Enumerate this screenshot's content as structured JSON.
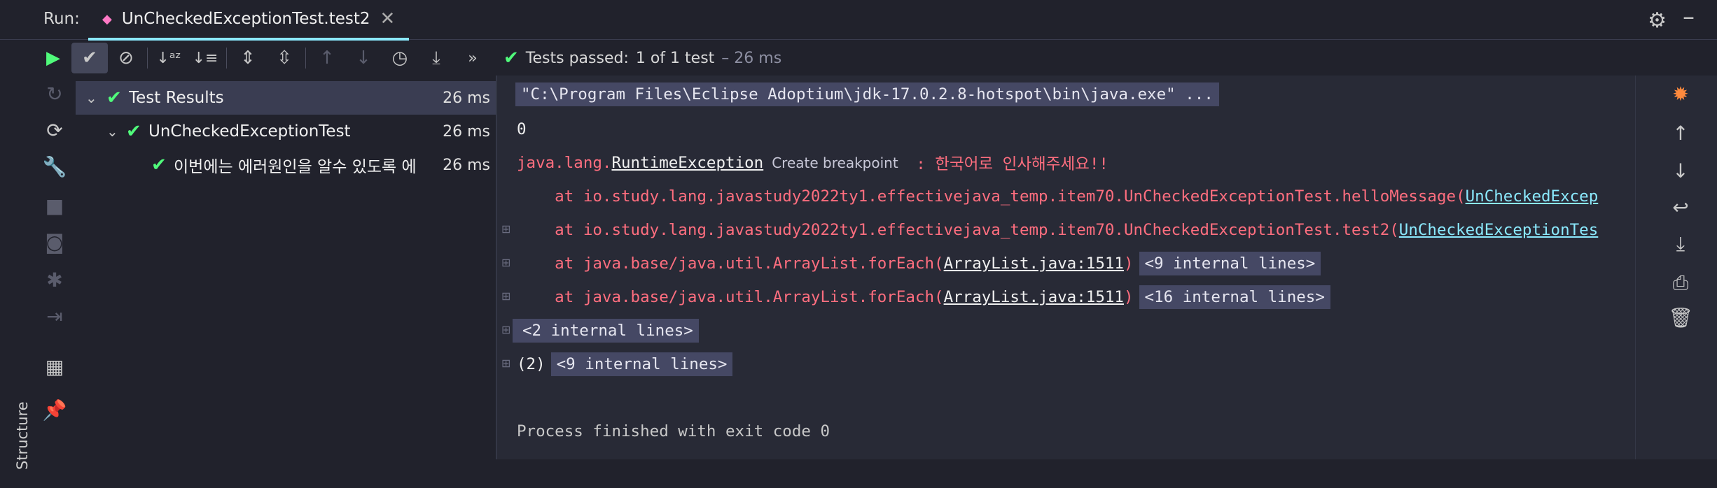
{
  "header": {
    "run_label": "Run:",
    "tab_title": "UnCheckedExceptionTest.test2",
    "tab_close": "✕",
    "settings_icon": "gear-icon",
    "minimize_icon": "minimize-icon"
  },
  "toolbar": {
    "status_passed": "Tests passed:",
    "status_count": "1 of 1 test",
    "status_time": "– 26 ms",
    "more_glyph": "»"
  },
  "tree": {
    "root": {
      "label": "Test Results",
      "time": "26 ms"
    },
    "suite": {
      "label": "UnCheckedExceptionTest",
      "time": "26 ms"
    },
    "test": {
      "label": "이번에는 에러원인을 알수 있도록 에",
      "time": "26 ms"
    }
  },
  "sidebar": {
    "structure_label": "Structure"
  },
  "console": {
    "cmd": "\"C:\\Program Files\\Eclipse Adoptium\\jdk-17.0.2.8-hotspot\\bin\\java.exe\" ...",
    "output_zero": "0",
    "exception_class": "java.lang.",
    "exception_link": "RuntimeException",
    "create_breakpoint": "Create breakpoint",
    "exception_msg": " : 한국어로 인사해주세요!!",
    "frame1_text": "    at io.study.lang.javastudy2022ty1.effectivejava_temp.item70.UnCheckedExceptionTest.helloMessage(",
    "frame1_link": "UnCheckedExcep",
    "frame2_text": "    at io.study.lang.javastudy2022ty1.effectivejava_temp.item70.UnCheckedExceptionTest.test2(",
    "frame2_link": "UnCheckedExceptionTes",
    "frame3_text": "    at java.base/java.util.ArrayList.forEach(",
    "frame3_link": "ArrayList.java:1511",
    "frame3_close": ")",
    "frame3_internal": "<9 internal lines>",
    "frame4_text": "    at java.base/java.util.ArrayList.forEach(",
    "frame4_link": "ArrayList.java:1511",
    "frame4_close": ")",
    "frame4_internal": "<16 internal lines>",
    "internal2": "<2 internal lines>",
    "paren2": "(2)",
    "internal9": "<9 internal lines>",
    "finished": "Process finished with exit code 0"
  },
  "colors": {
    "background": "#21222c",
    "console_bg": "#282a36",
    "pass_green": "#50fa7b",
    "error_red": "#ff6e7f",
    "link_cyan": "#8be9fd",
    "highlight": "#454864"
  }
}
